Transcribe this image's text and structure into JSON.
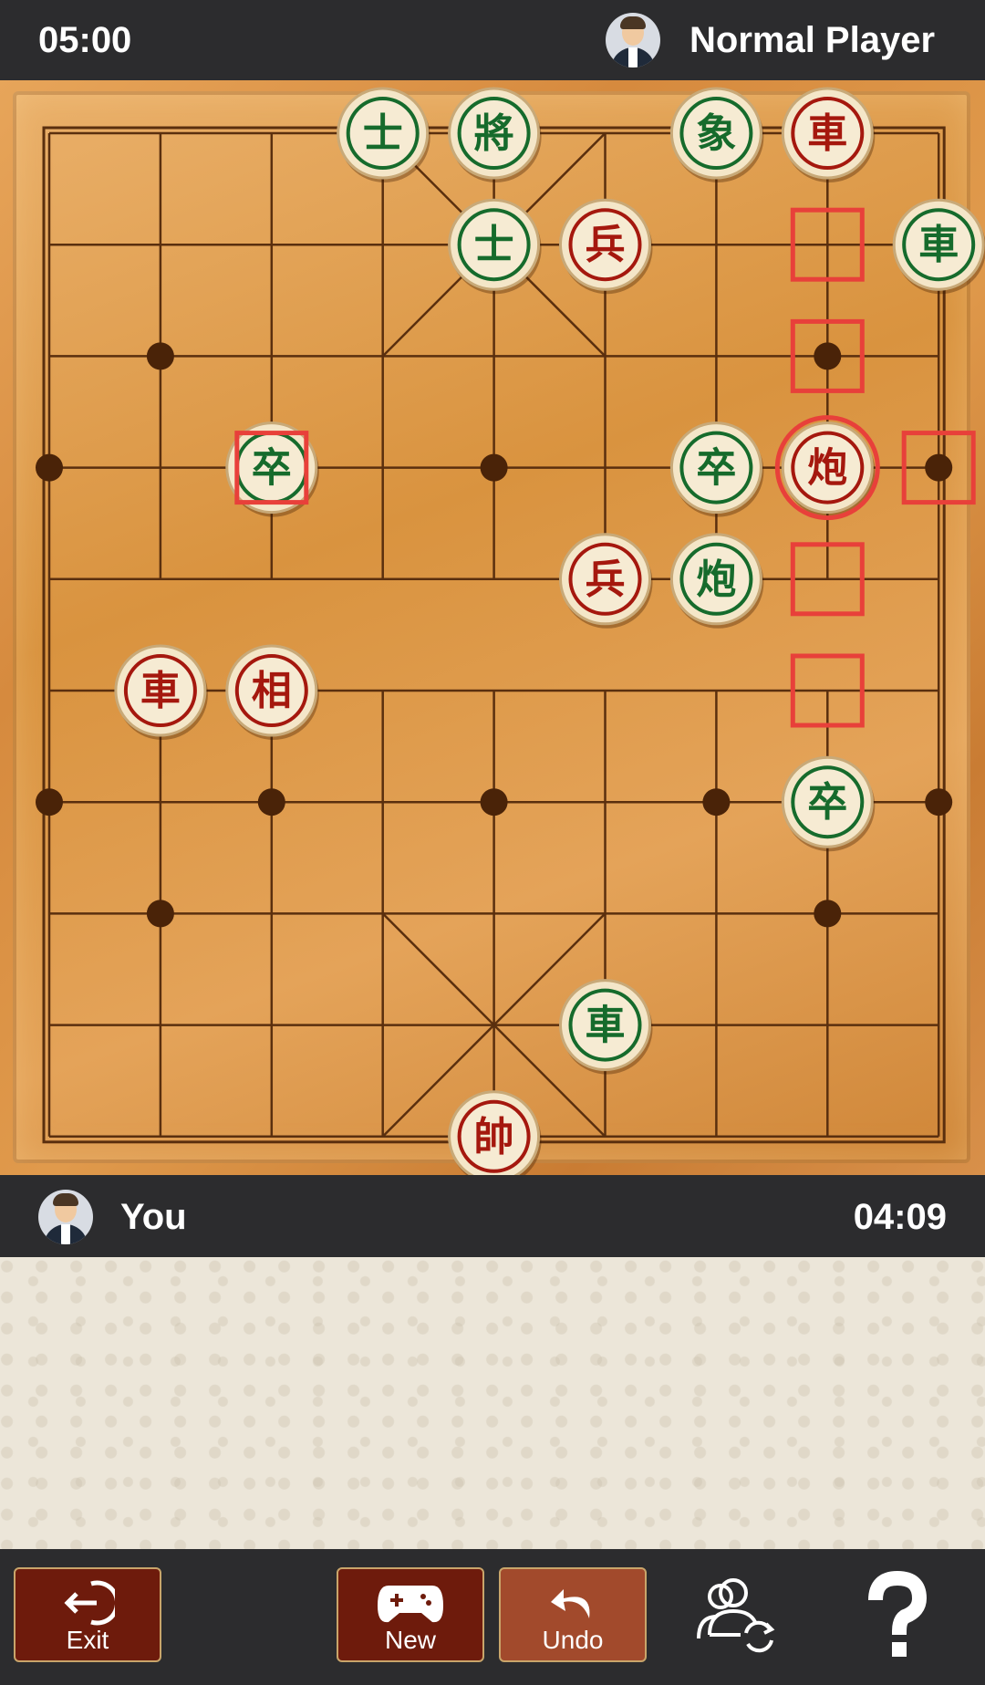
{
  "top": {
    "timer": "05:00",
    "player": "Normal Player"
  },
  "bottom": {
    "player": "You",
    "timer": "04:09"
  },
  "board": {
    "colors": {
      "red": "#a5180e",
      "green": "#166b2c",
      "line": "#5a2f0e",
      "highlight": "#e8403a"
    },
    "pieces": [
      {
        "char": "士",
        "side": "green",
        "col": 3,
        "row": 0
      },
      {
        "char": "將",
        "side": "green",
        "col": 4,
        "row": 0
      },
      {
        "char": "象",
        "side": "green",
        "col": 6,
        "row": 0
      },
      {
        "char": "車",
        "side": "red",
        "col": 7,
        "row": 0
      },
      {
        "char": "士",
        "side": "green",
        "col": 4,
        "row": 1
      },
      {
        "char": "兵",
        "side": "red",
        "col": 5,
        "row": 1
      },
      {
        "char": "車",
        "side": "green",
        "col": 8,
        "row": 1
      },
      {
        "char": "卒",
        "side": "green",
        "col": 2,
        "row": 3
      },
      {
        "char": "卒",
        "side": "green",
        "col": 6,
        "row": 3
      },
      {
        "char": "炮",
        "side": "red",
        "col": 7,
        "row": 3,
        "selected": true
      },
      {
        "char": "兵",
        "side": "red",
        "col": 5,
        "row": 4
      },
      {
        "char": "炮",
        "side": "green",
        "col": 6,
        "row": 4
      },
      {
        "char": "車",
        "side": "red",
        "col": 1,
        "row": 5
      },
      {
        "char": "相",
        "side": "red",
        "col": 2,
        "row": 5
      },
      {
        "char": "卒",
        "side": "green",
        "col": 7,
        "row": 6
      },
      {
        "char": "車",
        "side": "green",
        "col": 5,
        "row": 8
      },
      {
        "char": "帥",
        "side": "red",
        "col": 4,
        "row": 9
      }
    ],
    "move_targets": [
      {
        "col": 7,
        "row": 1
      },
      {
        "col": 7,
        "row": 2
      },
      {
        "col": 8,
        "row": 3
      },
      {
        "col": 7,
        "row": 4
      },
      {
        "col": 7,
        "row": 5
      },
      {
        "col": 2,
        "row": 3
      }
    ],
    "dots": [
      {
        "col": 1,
        "row": 2
      },
      {
        "col": 7,
        "row": 2
      },
      {
        "col": 0,
        "row": 3
      },
      {
        "col": 4,
        "row": 3
      },
      {
        "col": 8,
        "row": 3
      },
      {
        "col": 0,
        "row": 6
      },
      {
        "col": 2,
        "row": 6
      },
      {
        "col": 4,
        "row": 6
      },
      {
        "col": 6,
        "row": 6
      },
      {
        "col": 8,
        "row": 6
      },
      {
        "col": 1,
        "row": 7
      },
      {
        "col": 7,
        "row": 7
      }
    ]
  },
  "toolbar": {
    "exit": "Exit",
    "new": "New",
    "undo": "Undo"
  },
  "icons": [
    "avatar-icon",
    "exit-icon",
    "gamepad-icon",
    "undo-icon",
    "switch-players-icon",
    "help-icon"
  ]
}
